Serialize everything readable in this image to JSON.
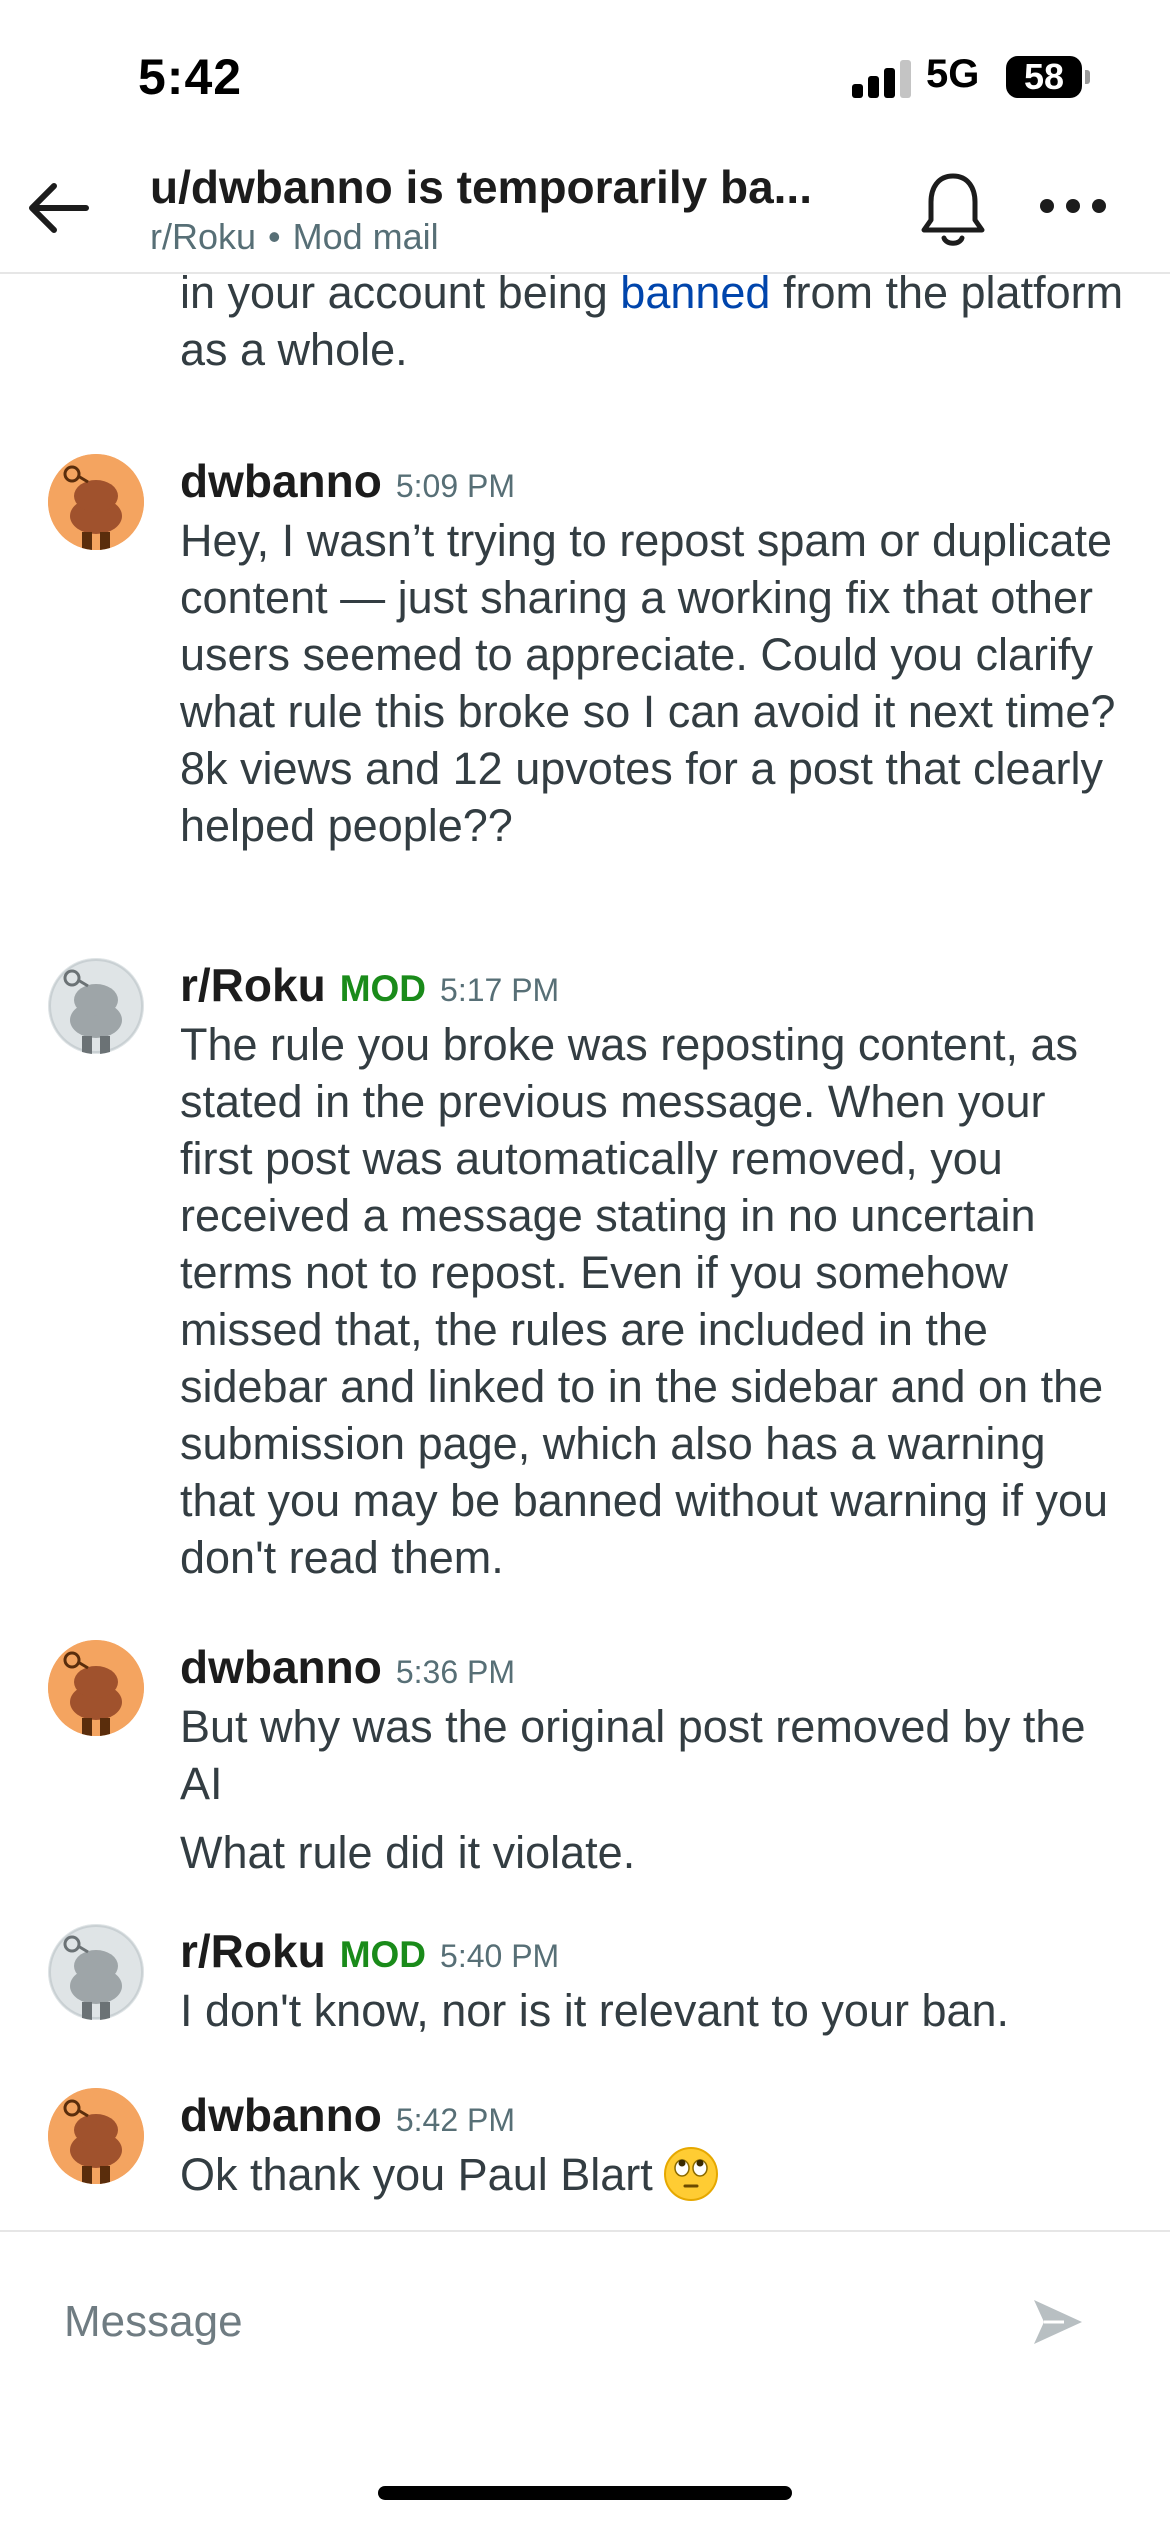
{
  "status_bar": {
    "time": "5:42",
    "network": "5G",
    "battery": "58"
  },
  "header": {
    "title": "u/dwbanno is temporarily ba...",
    "subreddit": "r/Roku",
    "separator": "•",
    "section": "Mod mail"
  },
  "partial_message": {
    "text_before": "in your account being ",
    "link_text": "banned",
    "text_after": " from the platform as a whole."
  },
  "messages": [
    {
      "author": "dwbanno",
      "mod": "",
      "time": "5:09 PM",
      "paragraphs": [
        "Hey, I wasn’t trying to repost spam or duplicate content — just sharing a working fix that other users seemed to appreciate. Could you clarify what rule this broke so I can avoid it next time?  8k views and 12 upvotes for a post that clearly helped people??"
      ]
    },
    {
      "author": "r/Roku",
      "mod": "MOD",
      "time": "5:17 PM",
      "paragraphs": [
        "The rule you broke was reposting content, as stated in the previous message. When your first post was automatically removed, you received a message stating in no uncertain terms not to repost. Even if you somehow missed that, the rules are included in the sidebar and linked to in the sidebar and on the submission page, which also has a warning that you may be banned without warning if you don't read them."
      ]
    },
    {
      "author": "dwbanno",
      "mod": "",
      "time": "5:36 PM",
      "paragraphs": [
        "But why was the original post removed by the AI",
        "What rule did it violate."
      ]
    },
    {
      "author": "r/Roku",
      "mod": "MOD",
      "time": "5:40 PM",
      "paragraphs": [
        "I don't know, nor is it relevant to your ban."
      ]
    },
    {
      "author": "dwbanno",
      "mod": "",
      "time": "5:42 PM",
      "paragraphs": [
        "Ok thank you Paul Blart"
      ]
    }
  ],
  "composer": {
    "placeholder": "Message"
  },
  "icons": {
    "back": "arrow-left-icon",
    "bell": "bell-icon",
    "more": "more-horizontal-icon",
    "send": "send-icon",
    "user_avatar": "snoo-orange-avatar",
    "mod_avatar": "snoo-gray-avatar",
    "emoji": "face-with-rolling-eyes-emoji"
  },
  "colors": {
    "link": "#0045ac",
    "mod_badge": "#1a8b1a",
    "user_avatar_bg": "#f4a460",
    "mod_avatar_bg": "#dfe4e6"
  }
}
